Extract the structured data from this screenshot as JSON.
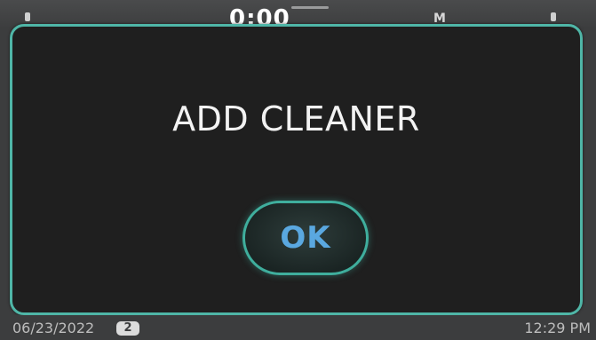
{
  "topbar": {
    "timer": "0:00",
    "mode": "M"
  },
  "dialog": {
    "title": "ADD CLEANER",
    "ok_label": "OK"
  },
  "statusbar": {
    "date": "06/23/2022",
    "badge_count": "2",
    "time": "12:29 PM"
  },
  "colors": {
    "accent": "#4fb6a7",
    "ok_text": "#5aa8e0",
    "dialog_bg": "#1f1f1f",
    "screen_bg": "#3c3d3e"
  }
}
